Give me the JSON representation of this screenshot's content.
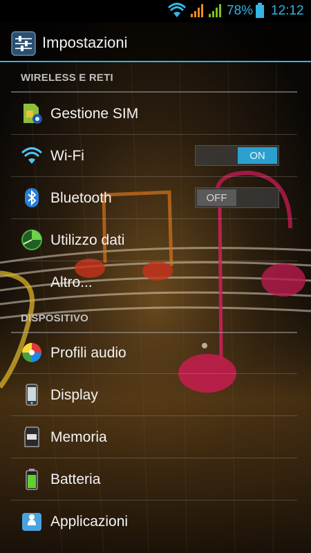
{
  "status_bar": {
    "battery_percent": "78%",
    "time": "12:12",
    "icons": [
      "wifi-signal-icon",
      "signal-orange-icon",
      "signal-green-icon",
      "battery-icon"
    ],
    "accent_color": "#33b5e5"
  },
  "action_bar": {
    "title": "Impostazioni",
    "icon": "settings-sliders-icon"
  },
  "sections": {
    "wireless": {
      "header": "WIRELESS E RETI"
    },
    "device": {
      "header": "DISPOSITIVO"
    }
  },
  "items": {
    "sim": {
      "label": "Gestione SIM",
      "icon": "sim-gear-icon"
    },
    "wifi": {
      "label": "Wi-Fi",
      "icon": "wifi-icon",
      "toggle": "ON"
    },
    "bluetooth": {
      "label": "Bluetooth",
      "icon": "bluetooth-icon",
      "toggle": "OFF"
    },
    "data_usage": {
      "label": "Utilizzo dati",
      "icon": "data-usage-icon"
    },
    "more": {
      "label": "Altro..."
    },
    "audio_profiles": {
      "label": "Profili audio",
      "icon": "audio-profiles-icon"
    },
    "display": {
      "label": "Display",
      "icon": "phone-display-icon"
    },
    "storage": {
      "label": "Memoria",
      "icon": "sd-card-icon"
    },
    "battery": {
      "label": "Batteria",
      "icon": "battery-icon"
    },
    "apps": {
      "label": "Applicazioni",
      "icon": "applications-icon"
    }
  },
  "colors": {
    "toggle_on": "#2ba0cf",
    "header_text": "#bfbfbf"
  }
}
